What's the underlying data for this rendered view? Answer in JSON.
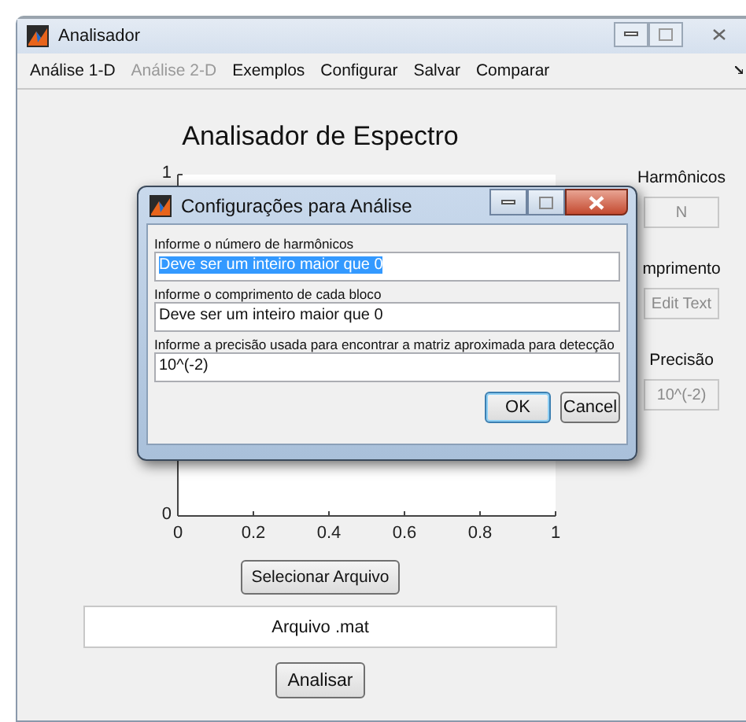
{
  "window": {
    "title": "Analisador"
  },
  "menu": [
    {
      "label": "Análise 1-D",
      "disabled": false
    },
    {
      "label": "Análise 2-D",
      "disabled": true
    },
    {
      "label": "Exemplos",
      "disabled": false
    },
    {
      "label": "Configurar",
      "disabled": false
    },
    {
      "label": "Salvar",
      "disabled": false
    },
    {
      "label": "Comparar",
      "disabled": false
    }
  ],
  "heading": "Analisador de Espectro",
  "chart": {
    "chart_data": {
      "type": "line",
      "xlim": [
        0,
        1
      ],
      "ylim": [
        0,
        1
      ],
      "xticks": [
        0,
        0.2,
        0.4,
        0.6,
        0.8,
        1
      ],
      "yticks": [
        0,
        1
      ]
    }
  },
  "side_panel": [
    {
      "label": "Harmônicos",
      "value": "N",
      "disabled": true
    },
    {
      "label": "mprimento",
      "value": "Edit Text",
      "disabled": true
    },
    {
      "label": "Precisão",
      "value": "10^(-2)",
      "disabled": true
    }
  ],
  "select_button": "Selecionar Arquivo",
  "file_field": {
    "value": "Arquivo .mat"
  },
  "analyze_button": "Analisar",
  "dialog": {
    "title": "Configurações para Análise",
    "fields": [
      {
        "label": "Informe o número de harmônicos",
        "value": "Deve ser um inteiro maior que 0",
        "selected": true
      },
      {
        "label": "Informe o comprimento de cada bloco",
        "value": "Deve ser um inteiro maior que 0",
        "selected": false
      },
      {
        "label": "Informe a precisão usada para encontrar a matriz aproximada para detecção",
        "value": "10^(-2)",
        "selected": false
      }
    ],
    "buttons": [
      {
        "label": "OK",
        "default": true
      },
      {
        "label": "Cancel",
        "default": false
      }
    ]
  }
}
